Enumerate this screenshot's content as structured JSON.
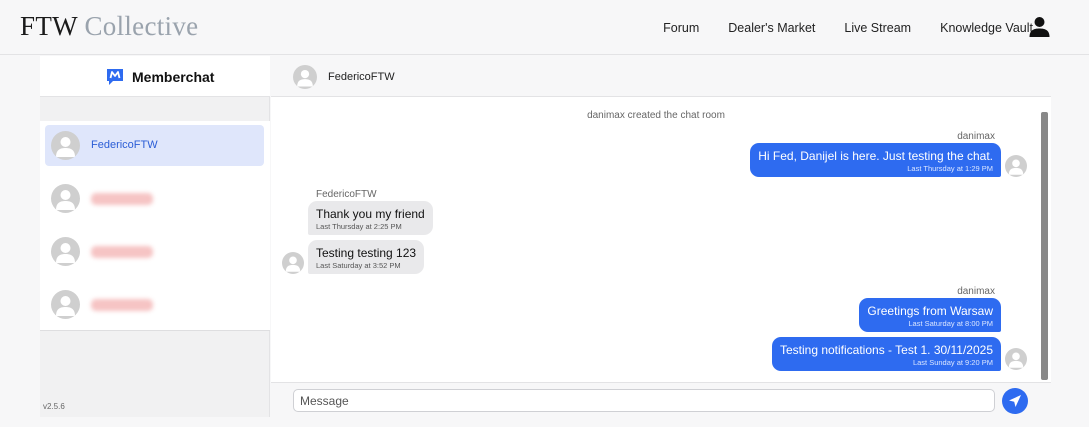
{
  "brand": {
    "part1": "FTW",
    "part2": "Collective"
  },
  "nav": {
    "items": [
      "Forum",
      "Dealer's Market",
      "Live Stream",
      "Knowledge Vault"
    ]
  },
  "sidebar": {
    "title": "Memberchat",
    "contacts": [
      {
        "name": "FedericoFTW",
        "active": true,
        "blurred": false
      },
      {
        "name": "",
        "blurred": true
      },
      {
        "name": "",
        "blurred": true
      },
      {
        "name": "",
        "blurred": true
      }
    ],
    "version": "v2.5.6"
  },
  "chat": {
    "header_name": "FedericoFTW",
    "system_message": "danimax created the chat room",
    "groups": [
      {
        "sender": "danimax",
        "direction": "out",
        "messages": [
          {
            "text": "Hi Fed, Danijel is here. Just testing the chat.",
            "time": "Last Thursday at 1:29 PM"
          }
        ]
      },
      {
        "sender": "FedericoFTW",
        "direction": "in",
        "messages": [
          {
            "text": "Thank you my friend",
            "time": "Last Thursday at 2:25 PM"
          },
          {
            "text": "Testing testing 123",
            "time": "Last Saturday at 3:52 PM"
          }
        ]
      },
      {
        "sender": "danimax",
        "direction": "out",
        "messages": [
          {
            "text": "Greetings from Warsaw",
            "time": "Last Saturday at 8:00 PM"
          },
          {
            "text": "Testing notifications - Test 1. 30/11/2025",
            "time": "Last Sunday at 9:20 PM"
          }
        ]
      }
    ]
  },
  "composer": {
    "placeholder": "Message"
  },
  "colors": {
    "accent": "#2e6bf0",
    "incoming_bubble": "#e9e9eb",
    "active_contact": "#dfe6fb"
  },
  "icons": {
    "user": "user-icon",
    "send": "send-icon",
    "brand": "memberchat-logo-icon",
    "avatar": "avatar-placeholder-icon"
  }
}
